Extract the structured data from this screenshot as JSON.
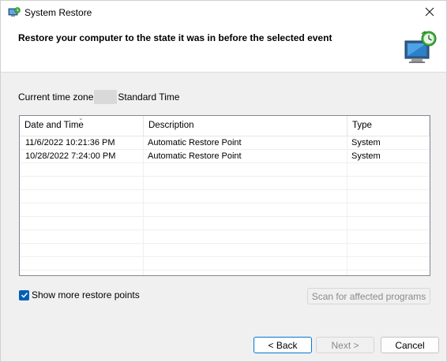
{
  "window": {
    "title": "System Restore",
    "title_icon": "system-restore-icon",
    "close_icon": "close-icon"
  },
  "header": {
    "heading": "Restore your computer to the state it was in before the selected event",
    "icon": "restore-monitor-icon"
  },
  "timezone": {
    "prefix": "Current time zone",
    "suffix": "Standard Time"
  },
  "table": {
    "columns": [
      "Date and Time",
      "Description",
      "Type"
    ],
    "rows": [
      {
        "date": "11/6/2022 10:21:36 PM",
        "description": "Automatic Restore Point",
        "type": "System"
      },
      {
        "date": "10/28/2022 7:24:00 PM",
        "description": "Automatic Restore Point",
        "type": "System"
      }
    ]
  },
  "options": {
    "show_more_label": "Show more restore points",
    "show_more_checked": true
  },
  "buttons": {
    "scan": "Scan for affected programs",
    "back": "< Back",
    "next": "Next >",
    "cancel": "Cancel"
  },
  "colors": {
    "accent": "#005fb8",
    "focus_border": "#0078d4"
  }
}
